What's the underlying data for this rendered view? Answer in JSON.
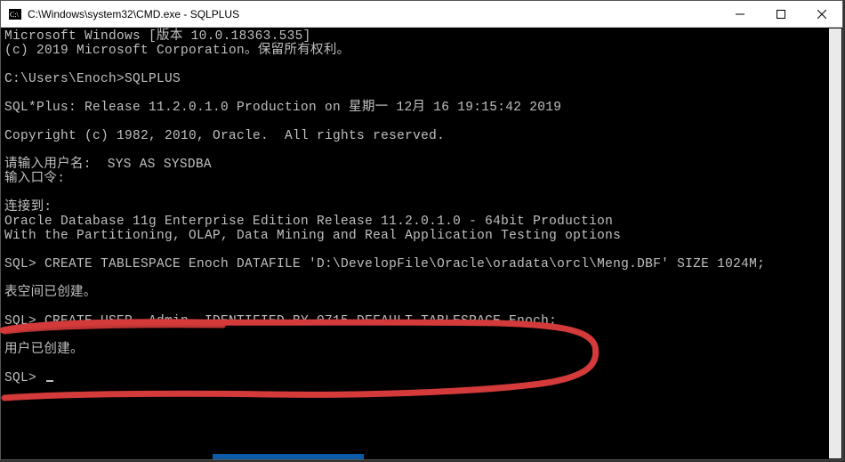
{
  "window": {
    "title": "C:\\Windows\\system32\\CMD.exe - SQLPLUS"
  },
  "term": {
    "l01": "Microsoft Windows [版本 10.0.18363.535]",
    "l02": "(c) 2019 Microsoft Corporation。保留所有权利。",
    "l03": "",
    "l04": "C:\\Users\\Enoch>SQLPLUS",
    "l05": "",
    "l06": "SQL*Plus: Release 11.2.0.1.0 Production on 星期一 12月 16 19:15:42 2019",
    "l07": "",
    "l08": "Copyright (c) 1982, 2010, Oracle.  All rights reserved.",
    "l09": "",
    "l10": "请输入用户名:  SYS AS SYSDBA",
    "l11": "输入口令:",
    "l12": "",
    "l13": "连接到:",
    "l14": "Oracle Database 11g Enterprise Edition Release 11.2.0.1.0 - 64bit Production",
    "l15": "With the Partitioning, OLAP, Data Mining and Real Application Testing options",
    "l16": "",
    "l17": "SQL> CREATE TABLESPACE Enoch DATAFILE 'D:\\DevelopFile\\Oracle\\oradata\\orcl\\Meng.DBF' SIZE 1024M;",
    "l18": "",
    "l19": "表空间已创建。",
    "l20": "",
    "l21": "SQL> CREATE USER  Admin  IDENTIFIED BY 0715 DEFAULT TABLESPACE Enoch;",
    "l22": "",
    "l23": "用户已创建。",
    "l24": "",
    "l25": "SQL> "
  },
  "annotation": {
    "stroke": "#d43a3a"
  }
}
